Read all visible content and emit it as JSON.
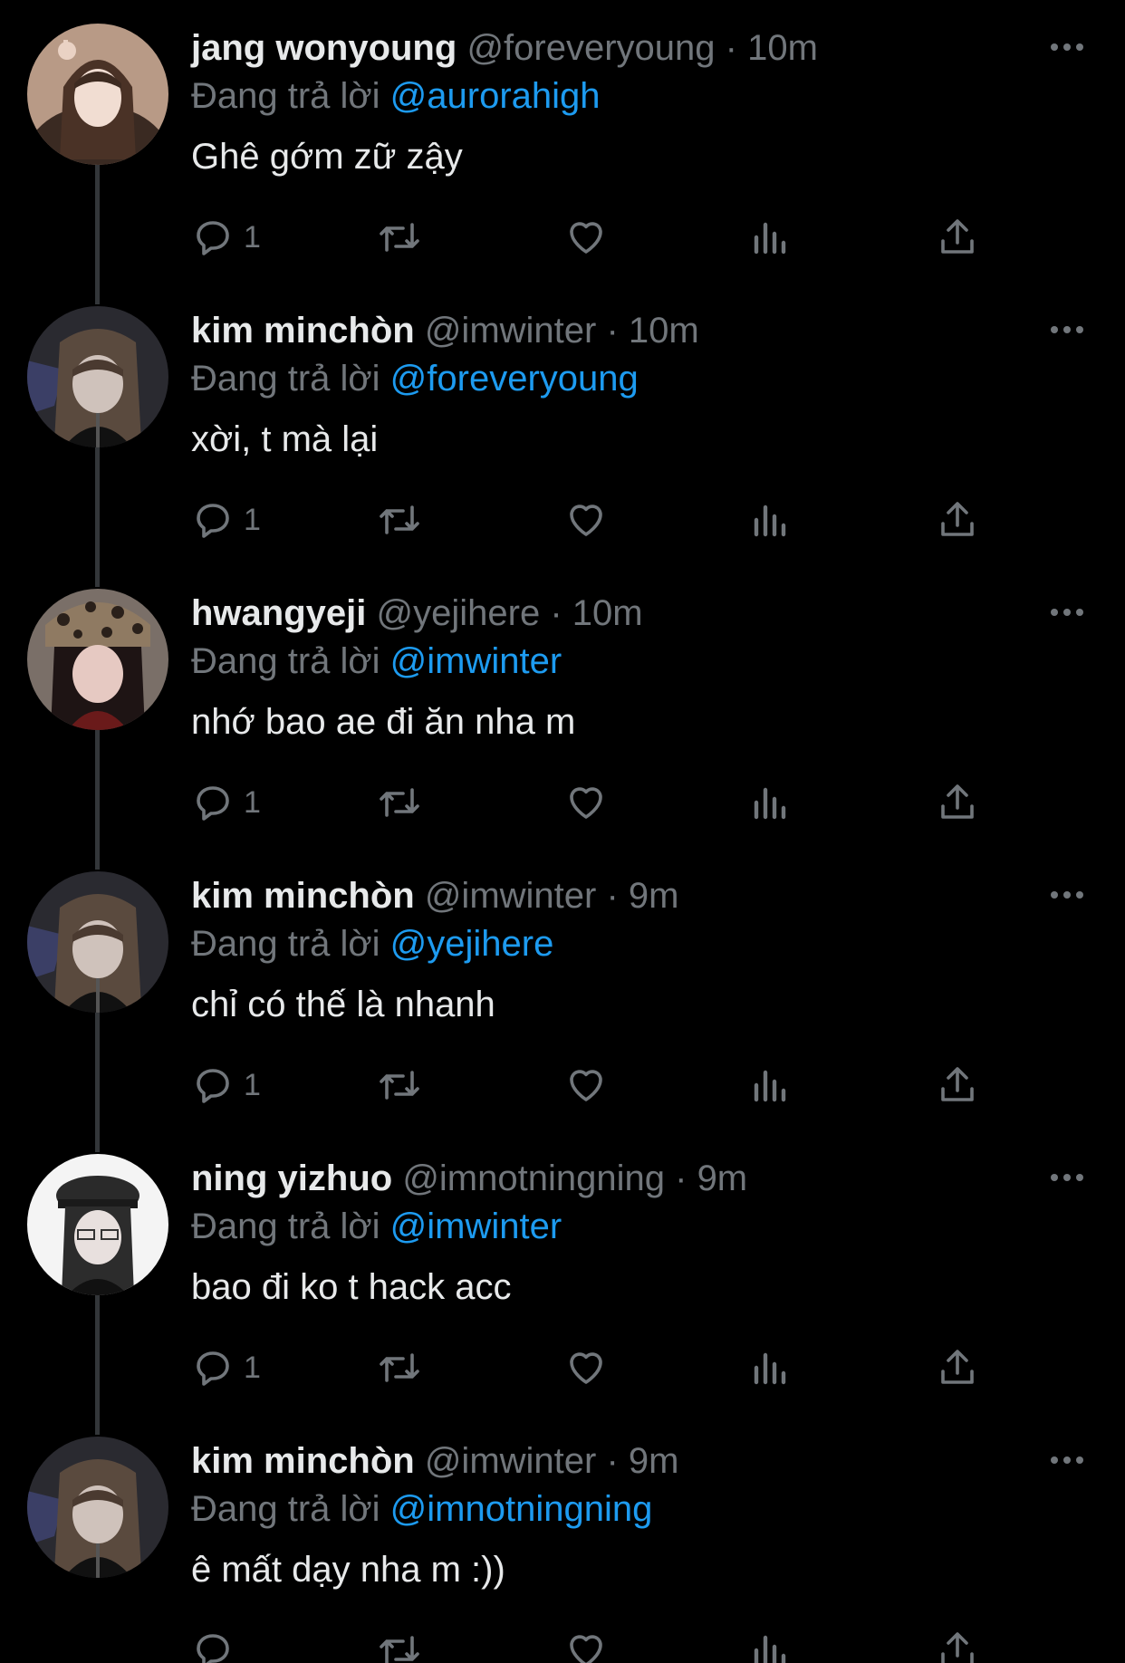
{
  "reply_prefix": "Đang trả lời",
  "colors": {
    "background": "#000000",
    "text": "#e7e9ea",
    "muted": "#71767b",
    "mention": "#1d9bf0",
    "thread_line": "#333639"
  },
  "tweets": [
    {
      "display_name": "jang wonyoung",
      "handle": "@foreveryoung",
      "separator": "·",
      "time": "10m",
      "reply_to": "@aurorahigh",
      "text": "Ghê gớm zữ zậy",
      "reply_count": "1",
      "avatar_icon": "avatar-photo"
    },
    {
      "display_name": "kim minchòn",
      "handle": "@imwinter",
      "separator": "·",
      "time": "10m",
      "reply_to": "@foreveryoung",
      "text": "xời, t mà lại",
      "reply_count": "1",
      "avatar_icon": "avatar-photo"
    },
    {
      "display_name": "hwangyeji",
      "handle": "@yejihere",
      "separator": "·",
      "time": "10m",
      "reply_to": "@imwinter",
      "text": "nhớ bao ae đi ăn nha m",
      "reply_count": "1",
      "avatar_icon": "avatar-photo"
    },
    {
      "display_name": "kim minchòn",
      "handle": "@imwinter",
      "separator": "·",
      "time": "9m",
      "reply_to": "@yejihere",
      "text": "chỉ có thế là nhanh",
      "reply_count": "1",
      "avatar_icon": "avatar-photo"
    },
    {
      "display_name": "ning yizhuo",
      "handle": "@imnotningning",
      "separator": "·",
      "time": "9m",
      "reply_to": "@imwinter",
      "text": "bao đi ko t hack acc",
      "reply_count": "1",
      "avatar_icon": "avatar-photo"
    },
    {
      "display_name": "kim minchòn",
      "handle": "@imwinter",
      "separator": "·",
      "time": "9m",
      "reply_to": "@imnotningning",
      "text": "ê mất dạy nha m :))",
      "reply_count": "",
      "avatar_icon": "avatar-photo"
    }
  ],
  "icons": {
    "reply": "reply-icon",
    "retweet": "retweet-icon",
    "like": "heart-icon",
    "views": "views-icon",
    "share": "share-icon",
    "more": "more-icon"
  }
}
